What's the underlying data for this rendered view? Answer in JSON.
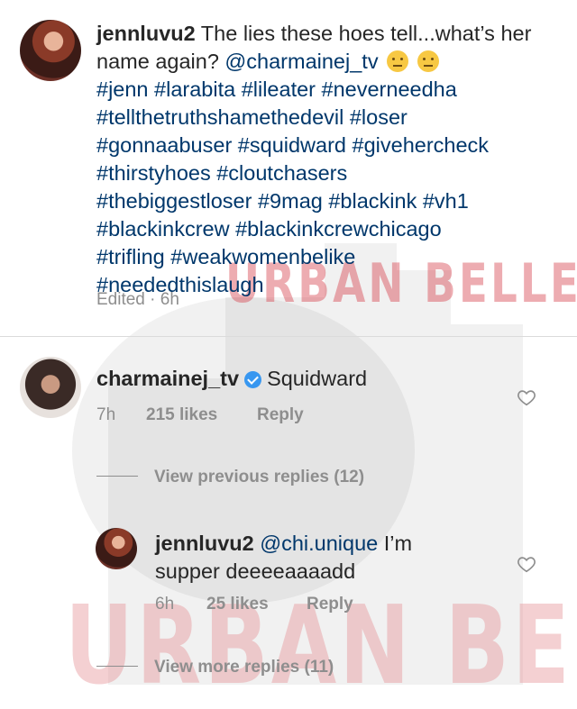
{
  "watermark": {
    "top_text": "URBAN BELLE",
    "bottom_text": "URBAN BELLE"
  },
  "post": {
    "username": "jennluvu2",
    "caption_text": "The lies these hoes tell...what’s her name again?",
    "mention": "@charmainej_tv",
    "emoji_1": "face-with-monocle",
    "emoji_2": "face-with-raised-eyebrow",
    "hashtag_lines": [
      "#jenn #larabita #lileater #neverneedha",
      "#tellthetruthshamethedevil #loser",
      "#gonnaabuser #squidward #givehercheck",
      "#thirstyhoes #cloutchasers",
      "#thebiggestloser #9mag #blackink #vh1",
      "#blackinkcrew #blackinkcrewchicago",
      "#trifling #weakwomenbelike",
      "#neededthislaugh"
    ],
    "edited_label": "Edited · 6h"
  },
  "comment": {
    "username": "charmainej_tv",
    "text": "Squidward",
    "time": "7h",
    "likes": "215 likes",
    "reply": "Reply"
  },
  "view_previous": "View previous replies (12)",
  "reply": {
    "username": "jennluvu2",
    "mention": "@chi.unique",
    "text_1": "I’m",
    "text_2": "supper deeeeaaaadd",
    "time": "6h",
    "likes": "25 likes",
    "reply": "Reply"
  },
  "view_more": "View more replies (11)",
  "colors": {
    "link": "#00376b",
    "muted": "#8e8e8e",
    "verified": "#3897f0"
  }
}
